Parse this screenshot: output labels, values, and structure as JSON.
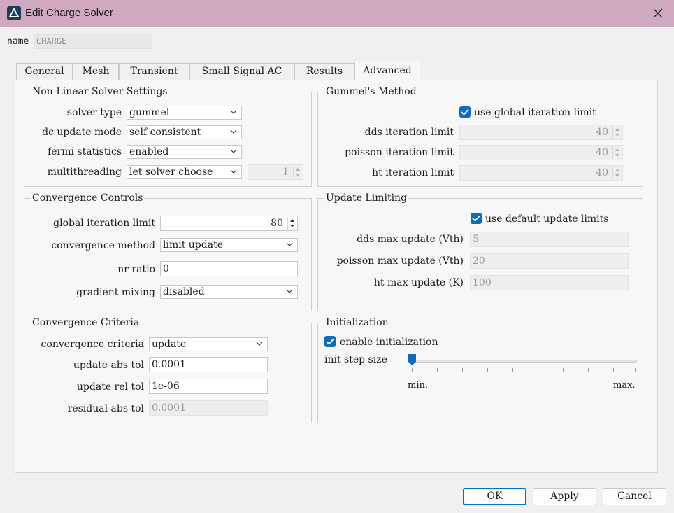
{
  "window": {
    "title": "Edit Charge Solver",
    "close_icon": "close-icon"
  },
  "name_row": {
    "label": "name",
    "value": "CHARGE"
  },
  "tabs": [
    "General",
    "Mesh",
    "Transient",
    "Small Signal AC",
    "Results",
    "Advanced"
  ],
  "active_tab": "Advanced",
  "nonlinear": {
    "title": "Non-Linear Solver Settings",
    "solver_type": {
      "label": "solver type",
      "value": "gummel"
    },
    "dc_update_mode": {
      "label": "dc update mode",
      "value": "self consistent"
    },
    "fermi_statistics": {
      "label": "fermi statistics",
      "value": "enabled"
    },
    "multithreading": {
      "label": "multithreading",
      "value": "let solver choose",
      "threads": "1"
    }
  },
  "gummel": {
    "title": "Gummel's Method",
    "use_global_label": "use global iteration limit",
    "use_global_checked": true,
    "dds": {
      "label": "dds iteration limit",
      "value": "40"
    },
    "poisson": {
      "label": "poisson iteration limit",
      "value": "40"
    },
    "ht": {
      "label": "ht iteration limit",
      "value": "40"
    }
  },
  "convergence_controls": {
    "title": "Convergence Controls",
    "global_iteration": {
      "label": "global iteration limit",
      "value": "80"
    },
    "method": {
      "label": "convergence method",
      "value": "limit update"
    },
    "nr_ratio": {
      "label": "nr ratio",
      "value": "0"
    },
    "gradient_mixing": {
      "label": "gradient mixing",
      "value": "disabled"
    }
  },
  "update_limiting": {
    "title": "Update Limiting",
    "use_default_label": "use default update limits",
    "use_default_checked": true,
    "dds_max": {
      "label": "dds max update (Vth)",
      "value": "5"
    },
    "poisson_max": {
      "label": "poisson  max update (Vth)",
      "value": "20"
    },
    "ht_max": {
      "label": "ht max update (K)",
      "value": "100"
    }
  },
  "convergence_criteria": {
    "title": "Convergence Criteria",
    "criteria": {
      "label": "convergence criteria",
      "value": "update"
    },
    "update_abs_tol": {
      "label": "update abs tol",
      "value": "0.0001"
    },
    "update_rel_tol": {
      "label": "update rel tol",
      "value": "1e-06"
    },
    "residual_abs_tol": {
      "label": "residual abs tol",
      "value": "0.0001"
    }
  },
  "initialization": {
    "title": "Initialization",
    "enable_label": "enable initialization",
    "enable_checked": true,
    "step_label": "init step size",
    "slider_min": "min.",
    "slider_max": "max.",
    "slider_level": 0
  },
  "buttons": {
    "ok": "OK",
    "apply": "Apply",
    "cancel": "Cancel"
  },
  "colors": {
    "titlebar": "#d0a8c0",
    "accent": "#0f6cbd"
  }
}
